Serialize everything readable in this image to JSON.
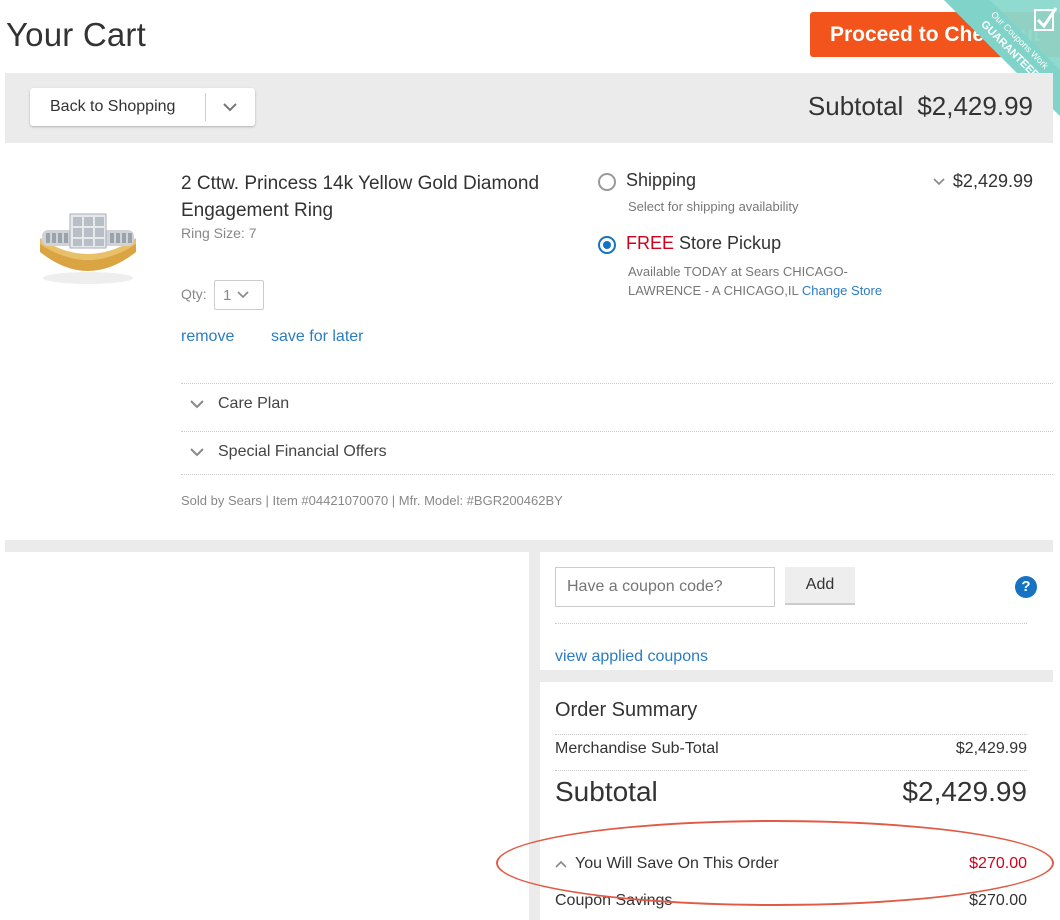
{
  "header": {
    "title": "Your Cart",
    "checkout_label": "Proceed to Checkout",
    "ribbon_line1": "Our Coupons Work",
    "ribbon_line2": "GUARANTEED"
  },
  "top_bar": {
    "back_label": "Back to Shopping",
    "subtotal_label": "Subtotal",
    "subtotal_value": "$2,429.99"
  },
  "item": {
    "name": "2 Cttw. Princess 14k Yellow Gold Diamond Engagement Ring",
    "ring_size": "Ring Size: 7",
    "qty_label": "Qty:",
    "qty_value": "1",
    "remove_label": "remove",
    "save_label": "save for later",
    "price": "$2,429.99",
    "meta": "Sold by Sears | Item #04421070070 | Mfr. Model: #BGR200462BY"
  },
  "fulfillment": {
    "shipping_label": "Shipping",
    "shipping_sub": "Select for shipping availability",
    "pickup_free": "FREE",
    "pickup_label": "Store Pickup",
    "pickup_sub": "Available TODAY at Sears CHICAGO-LAWRENCE - A CHICAGO,IL",
    "change_store": "Change Store",
    "selected": "pickup"
  },
  "accordions": {
    "care_plan": "Care Plan",
    "financial": "Special Financial Offers"
  },
  "coupon": {
    "placeholder": "Have a coupon code?",
    "add_label": "Add",
    "help": "?",
    "view_applied": "view applied coupons"
  },
  "summary": {
    "title": "Order Summary",
    "merch_label": "Merchandise Sub-Total",
    "merch_value": "$2,429.99",
    "subtotal_label": "Subtotal",
    "subtotal_value": "$2,429.99",
    "save_label": "You Will Save On This Order",
    "save_value": "$270.00",
    "coupon_label": "Coupon Savings",
    "coupon_value": "$270.00"
  },
  "colors": {
    "accent": "#f2541b",
    "link": "#2b7cc2",
    "savings": "#d0021b",
    "ribbon": "#7fd3c8",
    "annotation": "#e05a45"
  }
}
